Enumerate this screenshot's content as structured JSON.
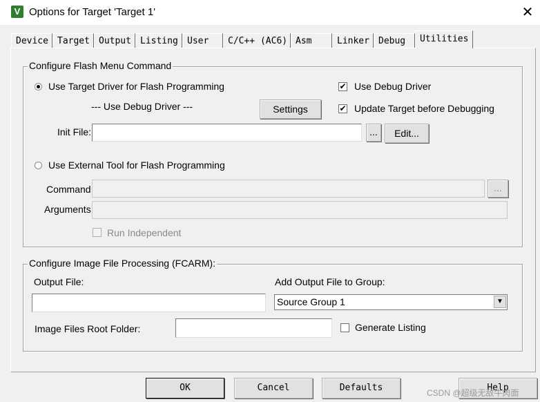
{
  "window": {
    "title": "Options for Target 'Target 1'",
    "icon_letter": "V",
    "close_glyph": "✕"
  },
  "tabs": [
    {
      "label": "Device"
    },
    {
      "label": "Target"
    },
    {
      "label": "Output"
    },
    {
      "label": "Listing"
    },
    {
      "label": "User"
    },
    {
      "label": "C/C++ (AC6)"
    },
    {
      "label": "Asm"
    },
    {
      "label": "Linker"
    },
    {
      "label": "Debug"
    },
    {
      "label": "Utilities",
      "active": true
    }
  ],
  "flash": {
    "legend": "Configure Flash Menu Command",
    "use_target_driver_label": "Use Target Driver for Flash Programming",
    "use_target_driver_selected": true,
    "driver_text": "--- Use Debug Driver ---",
    "settings_label": "Settings",
    "use_debug_driver_label": "Use Debug Driver",
    "use_debug_driver_checked": true,
    "update_target_label": "Update Target before Debugging",
    "update_target_checked": true,
    "init_file_label": "Init File:",
    "init_file_value": "",
    "browse_label": "...",
    "edit_label": "Edit...",
    "use_external_label": "Use External Tool for Flash Programming",
    "use_external_selected": false,
    "command_label": "Command:",
    "command_value": "",
    "command_browse_label": "...",
    "arguments_label": "Arguments:",
    "arguments_value": "",
    "run_independent_label": "Run Independent",
    "run_independent_checked": false
  },
  "image": {
    "legend": "Configure Image File Processing (FCARM):",
    "output_file_label": "Output File:",
    "output_file_value": "",
    "add_output_label": "Add Output File  to Group:",
    "group_selected": "Source Group 1",
    "root_folder_label": "Image Files Root Folder:",
    "root_folder_value": "",
    "generate_listing_label": "Generate Listing",
    "generate_listing_checked": false
  },
  "footer": {
    "ok_label": "OK",
    "cancel_label": "Cancel",
    "defaults_label": "Defaults",
    "help_label": "Help"
  },
  "watermark": "CSDN @超级无敌牛肉面",
  "glyphs": {
    "check": "✔",
    "arrow": "▼"
  },
  "colors": {
    "dialog_bg": "#f0f0f0",
    "title_bg": "#ffffff",
    "icon_green": "#2f7d2f"
  }
}
